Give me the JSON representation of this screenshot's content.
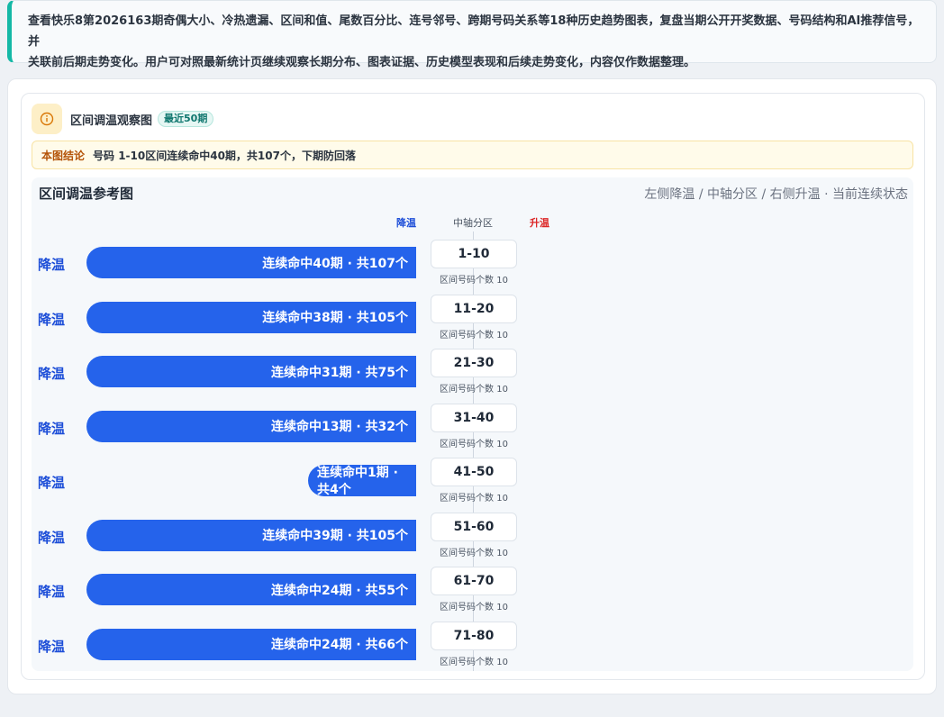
{
  "intro": {
    "line1": "查看快乐8第2026163期奇偶大小、冷热遗漏、区间和值、尾数百分比、连号邻号、跨期号码关系等18种历史趋势图表，复盘当期公开开奖数据、号码结构和AI推荐信号，并",
    "line2": "关联前后期走势变化。用户可对照最新统计页继续观察长期分布、图表证据、历史模型表现和后续走势变化，内容仅作数据整理。"
  },
  "card": {
    "icon": "info-icon",
    "title": "区间调温观察图",
    "badge": "最近50期",
    "conclusion_tag": "本图结论",
    "conclusion_text": "号码 1-10区间连续命中40期，共107个，下期防回落"
  },
  "chart": {
    "title": "区间调温参考图",
    "subtitle": "左侧降温 / 中轴分区 / 右侧升温 · 当前连续状态",
    "legend_cool": "降温",
    "legend_axis": "中轴分区",
    "legend_warm": "升温"
  },
  "colors": {
    "bar": "#2563eb",
    "cool_text": "#1d4ed8",
    "warm_text": "#dc2626",
    "accent": "#14b8a6"
  },
  "chart_data": {
    "type": "bar",
    "categories": [
      "1-10",
      "11-20",
      "21-30",
      "31-40",
      "41-50",
      "51-60",
      "61-70",
      "71-80"
    ],
    "row_state": [
      "降温",
      "降温",
      "降温",
      "降温",
      "降温",
      "降温",
      "降温",
      "降温"
    ],
    "streak": [
      40,
      38,
      31,
      13,
      1,
      39,
      24,
      24
    ],
    "total": [
      107,
      105,
      75,
      32,
      4,
      105,
      55,
      66
    ],
    "bar_labels": [
      "连续命中40期 · 共107个",
      "连续命中38期 · 共105个",
      "连续命中31期 · 共75个",
      "连续命中13期 · 共32个",
      "连续命中1期 · 共4个",
      "连续命中39期 · 共105个",
      "连续命中24期 · 共55个",
      "连续命中24期 · 共66个"
    ],
    "count_labels": [
      "区间号码个数 10",
      "区间号码个数 10",
      "区间号码个数 10",
      "区间号码个数 10",
      "区间号码个数 10",
      "区间号码个数 10",
      "区间号码个数 10",
      "区间号码个数 10"
    ]
  }
}
